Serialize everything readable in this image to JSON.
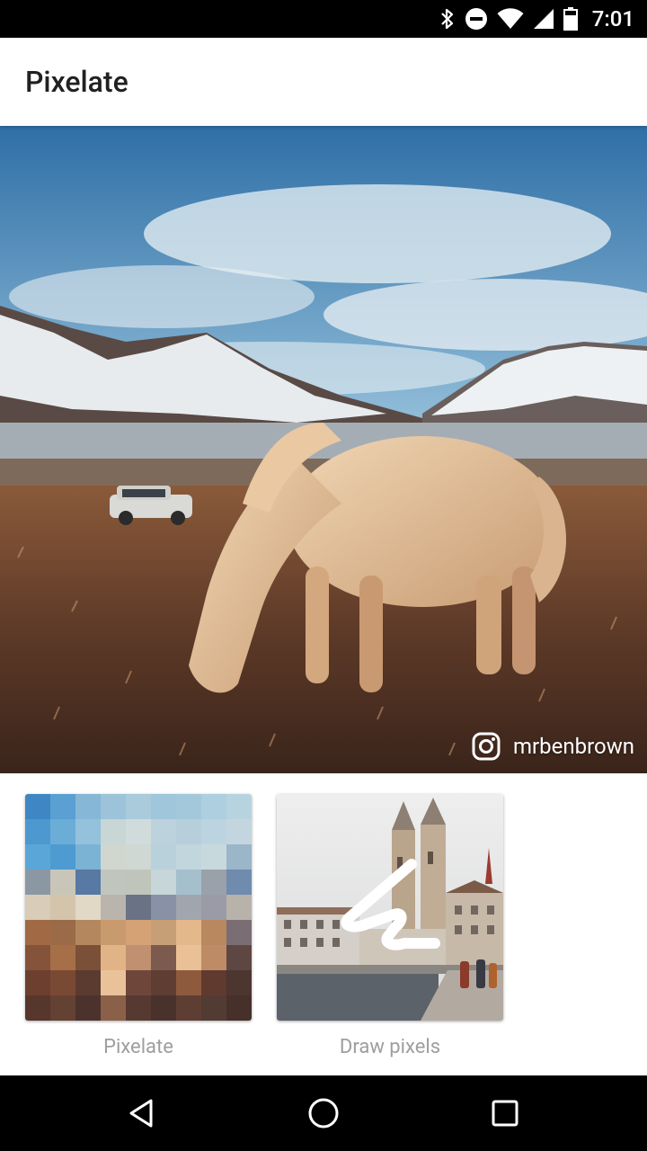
{
  "status_bar": {
    "time": "7:01",
    "icons": [
      "bluetooth-icon",
      "do-not-disturb-icon",
      "wifi-icon",
      "signal-icon",
      "battery-icon"
    ]
  },
  "app_bar": {
    "title": "Pixelate"
  },
  "hero": {
    "attribution_icon": "instagram-icon",
    "attribution_name": "mrbenbrown"
  },
  "tools": [
    {
      "label": "Pixelate",
      "icon": "pixelate-thumbnail"
    },
    {
      "label": "Draw pixels",
      "icon": "draw-pixels-thumbnail"
    }
  ],
  "pixel_colors": [
    "#3f87c4",
    "#5aa0d2",
    "#86b7d6",
    "#9cc3da",
    "#a9cbdc",
    "#9fc6da",
    "#a3c8dc",
    "#aecfdf",
    "#b8d3e0",
    "#4e98d0",
    "#6aaed8",
    "#94c1db",
    "#c8d6d6",
    "#d0dcdc",
    "#bcd2dc",
    "#b6cfdb",
    "#bcd4df",
    "#c3d6df",
    "#5aa6d8",
    "#4d9bd1",
    "#7bb3d4",
    "#d1d7cf",
    "#cfd8d2",
    "#b9d1db",
    "#c2d6dd",
    "#c8d9de",
    "#9bb5c9",
    "#8b98a4",
    "#c9c6b9",
    "#5779a3",
    "#c0c6bd",
    "#bfc5bb",
    "#c6d6d9",
    "#a5bfcd",
    "#9aa1aa",
    "#6f8bae",
    "#d9ccb8",
    "#d4c4ab",
    "#e2d8c6",
    "#b9b5ac",
    "#6a7285",
    "#8891a5",
    "#a0a5ae",
    "#9a9ba6",
    "#b8b3aa",
    "#a16a44",
    "#9b6a47",
    "#b4875e",
    "#c99a6e",
    "#d5a276",
    "#c79f77",
    "#e3b88a",
    "#b9885f",
    "#7a6d73",
    "#85533a",
    "#a66f47",
    "#7b5038",
    "#e0b487",
    "#c09070",
    "#7d5a4e",
    "#eac196",
    "#bd8c66",
    "#5e4742",
    "#6c3f2e",
    "#7a4934",
    "#5b3b30",
    "#eac29a",
    "#6e473a",
    "#5f3d33",
    "#8e5a3e",
    "#603a2f",
    "#4d3530",
    "#57362b",
    "#634233",
    "#4b322c",
    "#8a6049",
    "#563a31",
    "#4a322c",
    "#5e3e33",
    "#523b33",
    "#473029"
  ]
}
